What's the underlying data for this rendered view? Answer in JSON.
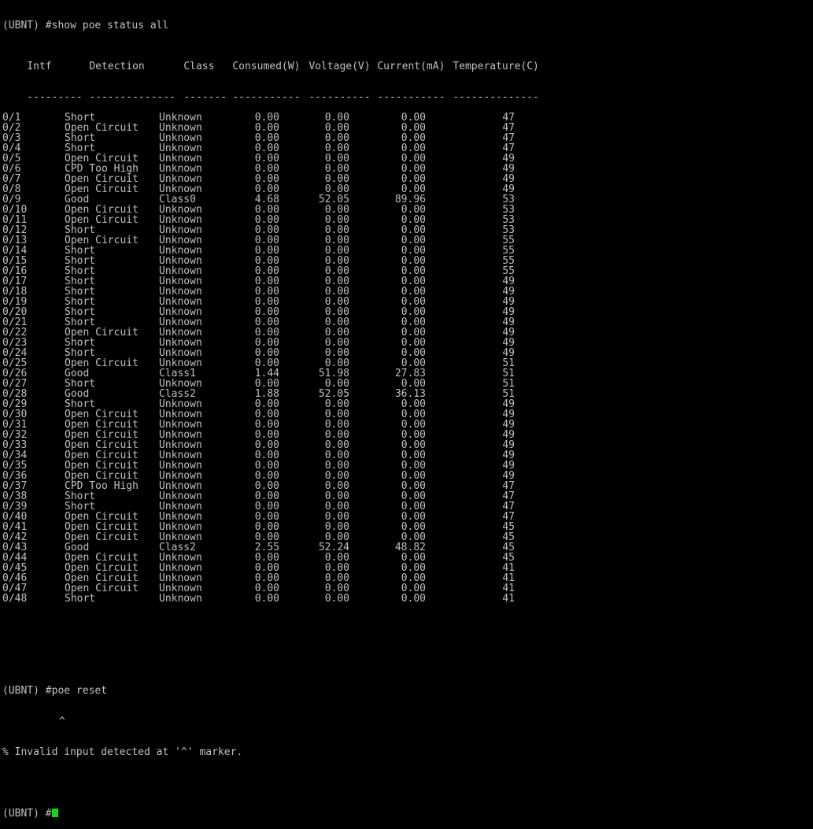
{
  "command_line": "(UBNT) #show poe status all",
  "headers": [
    "Intf",
    "Detection",
    "Class",
    "Consumed(W)",
    "Voltage(V)",
    "Current(mA)",
    "Temperature(C)"
  ],
  "separators": [
    "---------",
    "--------------",
    "-------",
    "-----------",
    "----------",
    "-----------",
    "--------------"
  ],
  "rows": [
    [
      "0/1",
      "Short",
      "Unknown",
      "0.00",
      "0.00",
      "0.00",
      "47"
    ],
    [
      "0/2",
      "Open Circuit",
      "Unknown",
      "0.00",
      "0.00",
      "0.00",
      "47"
    ],
    [
      "0/3",
      "Short",
      "Unknown",
      "0.00",
      "0.00",
      "0.00",
      "47"
    ],
    [
      "0/4",
      "Short",
      "Unknown",
      "0.00",
      "0.00",
      "0.00",
      "47"
    ],
    [
      "0/5",
      "Open Circuit",
      "Unknown",
      "0.00",
      "0.00",
      "0.00",
      "49"
    ],
    [
      "0/6",
      "CPD Too High",
      "Unknown",
      "0.00",
      "0.00",
      "0.00",
      "49"
    ],
    [
      "0/7",
      "Open Circuit",
      "Unknown",
      "0.00",
      "0.00",
      "0.00",
      "49"
    ],
    [
      "0/8",
      "Open Circuit",
      "Unknown",
      "0.00",
      "0.00",
      "0.00",
      "49"
    ],
    [
      "0/9",
      "Good",
      "Class0",
      "4.68",
      "52.05",
      "89.96",
      "53"
    ],
    [
      "0/10",
      "Open Circuit",
      "Unknown",
      "0.00",
      "0.00",
      "0.00",
      "53"
    ],
    [
      "0/11",
      "Open Circuit",
      "Unknown",
      "0.00",
      "0.00",
      "0.00",
      "53"
    ],
    [
      "0/12",
      "Short",
      "Unknown",
      "0.00",
      "0.00",
      "0.00",
      "53"
    ],
    [
      "0/13",
      "Open Circuit",
      "Unknown",
      "0.00",
      "0.00",
      "0.00",
      "55"
    ],
    [
      "0/14",
      "Short",
      "Unknown",
      "0.00",
      "0.00",
      "0.00",
      "55"
    ],
    [
      "0/15",
      "Short",
      "Unknown",
      "0.00",
      "0.00",
      "0.00",
      "55"
    ],
    [
      "0/16",
      "Short",
      "Unknown",
      "0.00",
      "0.00",
      "0.00",
      "55"
    ],
    [
      "0/17",
      "Short",
      "Unknown",
      "0.00",
      "0.00",
      "0.00",
      "49"
    ],
    [
      "0/18",
      "Short",
      "Unknown",
      "0.00",
      "0.00",
      "0.00",
      "49"
    ],
    [
      "0/19",
      "Short",
      "Unknown",
      "0.00",
      "0.00",
      "0.00",
      "49"
    ],
    [
      "0/20",
      "Short",
      "Unknown",
      "0.00",
      "0.00",
      "0.00",
      "49"
    ],
    [
      "0/21",
      "Short",
      "Unknown",
      "0.00",
      "0.00",
      "0.00",
      "49"
    ],
    [
      "0/22",
      "Open Circuit",
      "Unknown",
      "0.00",
      "0.00",
      "0.00",
      "49"
    ],
    [
      "0/23",
      "Short",
      "Unknown",
      "0.00",
      "0.00",
      "0.00",
      "49"
    ],
    [
      "0/24",
      "Short",
      "Unknown",
      "0.00",
      "0.00",
      "0.00",
      "49"
    ],
    [
      "0/25",
      "Open Circuit",
      "Unknown",
      "0.00",
      "0.00",
      "0.00",
      "51"
    ],
    [
      "0/26",
      "Good",
      "Class1",
      "1.44",
      "51.98",
      "27.83",
      "51"
    ],
    [
      "0/27",
      "Short",
      "Unknown",
      "0.00",
      "0.00",
      "0.00",
      "51"
    ],
    [
      "0/28",
      "Good",
      "Class2",
      "1.88",
      "52.05",
      "36.13",
      "51"
    ],
    [
      "0/29",
      "Short",
      "Unknown",
      "0.00",
      "0.00",
      "0.00",
      "49"
    ],
    [
      "0/30",
      "Open Circuit",
      "Unknown",
      "0.00",
      "0.00",
      "0.00",
      "49"
    ],
    [
      "0/31",
      "Open Circuit",
      "Unknown",
      "0.00",
      "0.00",
      "0.00",
      "49"
    ],
    [
      "0/32",
      "Open Circuit",
      "Unknown",
      "0.00",
      "0.00",
      "0.00",
      "49"
    ],
    [
      "0/33",
      "Open Circuit",
      "Unknown",
      "0.00",
      "0.00",
      "0.00",
      "49"
    ],
    [
      "0/34",
      "Open Circuit",
      "Unknown",
      "0.00",
      "0.00",
      "0.00",
      "49"
    ],
    [
      "0/35",
      "Open Circuit",
      "Unknown",
      "0.00",
      "0.00",
      "0.00",
      "49"
    ],
    [
      "0/36",
      "Open Circuit",
      "Unknown",
      "0.00",
      "0.00",
      "0.00",
      "49"
    ],
    [
      "0/37",
      "CPD Too High",
      "Unknown",
      "0.00",
      "0.00",
      "0.00",
      "47"
    ],
    [
      "0/38",
      "Short",
      "Unknown",
      "0.00",
      "0.00",
      "0.00",
      "47"
    ],
    [
      "0/39",
      "Short",
      "Unknown",
      "0.00",
      "0.00",
      "0.00",
      "47"
    ],
    [
      "0/40",
      "Open Circuit",
      "Unknown",
      "0.00",
      "0.00",
      "0.00",
      "47"
    ],
    [
      "0/41",
      "Open Circuit",
      "Unknown",
      "0.00",
      "0.00",
      "0.00",
      "45"
    ],
    [
      "0/42",
      "Open Circuit",
      "Unknown",
      "0.00",
      "0.00",
      "0.00",
      "45"
    ],
    [
      "0/43",
      "Good",
      "Class2",
      "2.55",
      "52.24",
      "48.82",
      "45"
    ],
    [
      "0/44",
      "Open Circuit",
      "Unknown",
      "0.00",
      "0.00",
      "0.00",
      "45"
    ],
    [
      "0/45",
      "Open Circuit",
      "Unknown",
      "0.00",
      "0.00",
      "0.00",
      "41"
    ],
    [
      "0/46",
      "Open Circuit",
      "Unknown",
      "0.00",
      "0.00",
      "0.00",
      "41"
    ],
    [
      "0/47",
      "Open Circuit",
      "Unknown",
      "0.00",
      "0.00",
      "0.00",
      "41"
    ],
    [
      "0/48",
      "Short",
      "Unknown",
      "0.00",
      "0.00",
      "0.00",
      "41"
    ]
  ],
  "reset_command": "(UBNT) #poe reset",
  "caret_marker": "^",
  "error_message": "% Invalid input detected at '^' marker.",
  "final_prompt": "(UBNT) #",
  "colors": {
    "background": "#000000",
    "text": "#c0c0c0",
    "cursor": "#16d616"
  }
}
